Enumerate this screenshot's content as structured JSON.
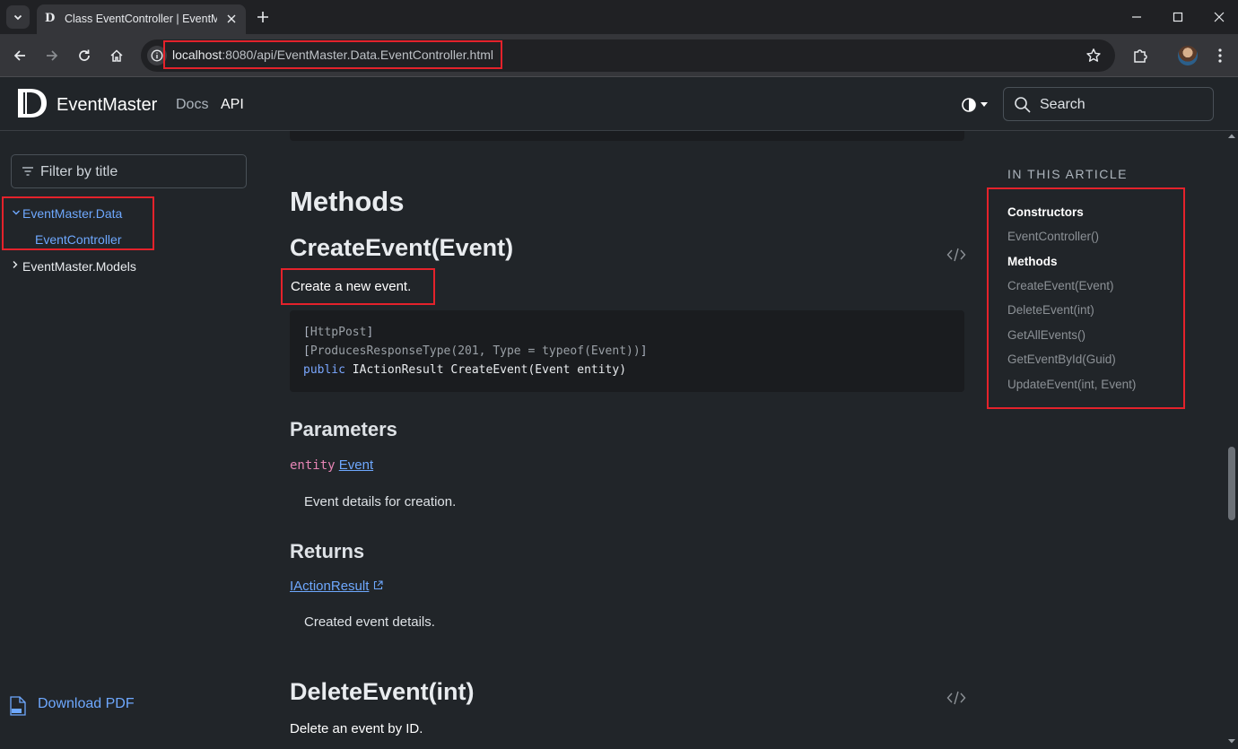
{
  "browser": {
    "tab_title": "Class EventController | EventMa",
    "url_host": "localhost",
    "url_path": ":8080/api/EventMaster.Data.EventController.html"
  },
  "site": {
    "brand": "EventMaster",
    "nav": {
      "docs": "Docs",
      "api": "API"
    },
    "search_placeholder": "Search"
  },
  "sidebar": {
    "filter_placeholder": "Filter by title",
    "namespace_data": "EventMaster.Data",
    "event_controller": "EventController",
    "namespace_models": "EventMaster.Models",
    "download_pdf": "Download PDF"
  },
  "content": {
    "methods_heading": "Methods",
    "create_event": {
      "heading": "CreateEvent(Event)",
      "summary": "Create a new event.",
      "code": {
        "line1_attr": "HttpPost",
        "line2_attr": "ProducesResponseType(201, Type = typeof(Event))",
        "line3_kw": "public",
        "line3_rest": " IActionResult CreateEvent(Event entity)"
      },
      "parameters_heading": "Parameters",
      "param_name": "entity",
      "param_type": "Event",
      "param_desc": "Event details for creation.",
      "returns_heading": "Returns",
      "returns_type": "IActionResult",
      "returns_desc": "Created event details."
    },
    "delete_event": {
      "heading": "DeleteEvent(int)",
      "summary": "Delete an event by ID."
    }
  },
  "in_this_article": {
    "title": "IN THIS ARTICLE",
    "constructors": "Constructors",
    "ctor_event_controller": "EventController()",
    "methods": "Methods",
    "create_event": "CreateEvent(Event)",
    "delete_event": "DeleteEvent(int)",
    "get_all_events": "GetAllEvents()",
    "get_event_by_id": "GetEventById(Guid)",
    "update_event": "UpdateEvent(int, Event)"
  },
  "colors": {
    "highlight_box": "#e4222b",
    "link": "#6ea8fe",
    "background": "#212529",
    "code_background": "#1a1c1f"
  }
}
